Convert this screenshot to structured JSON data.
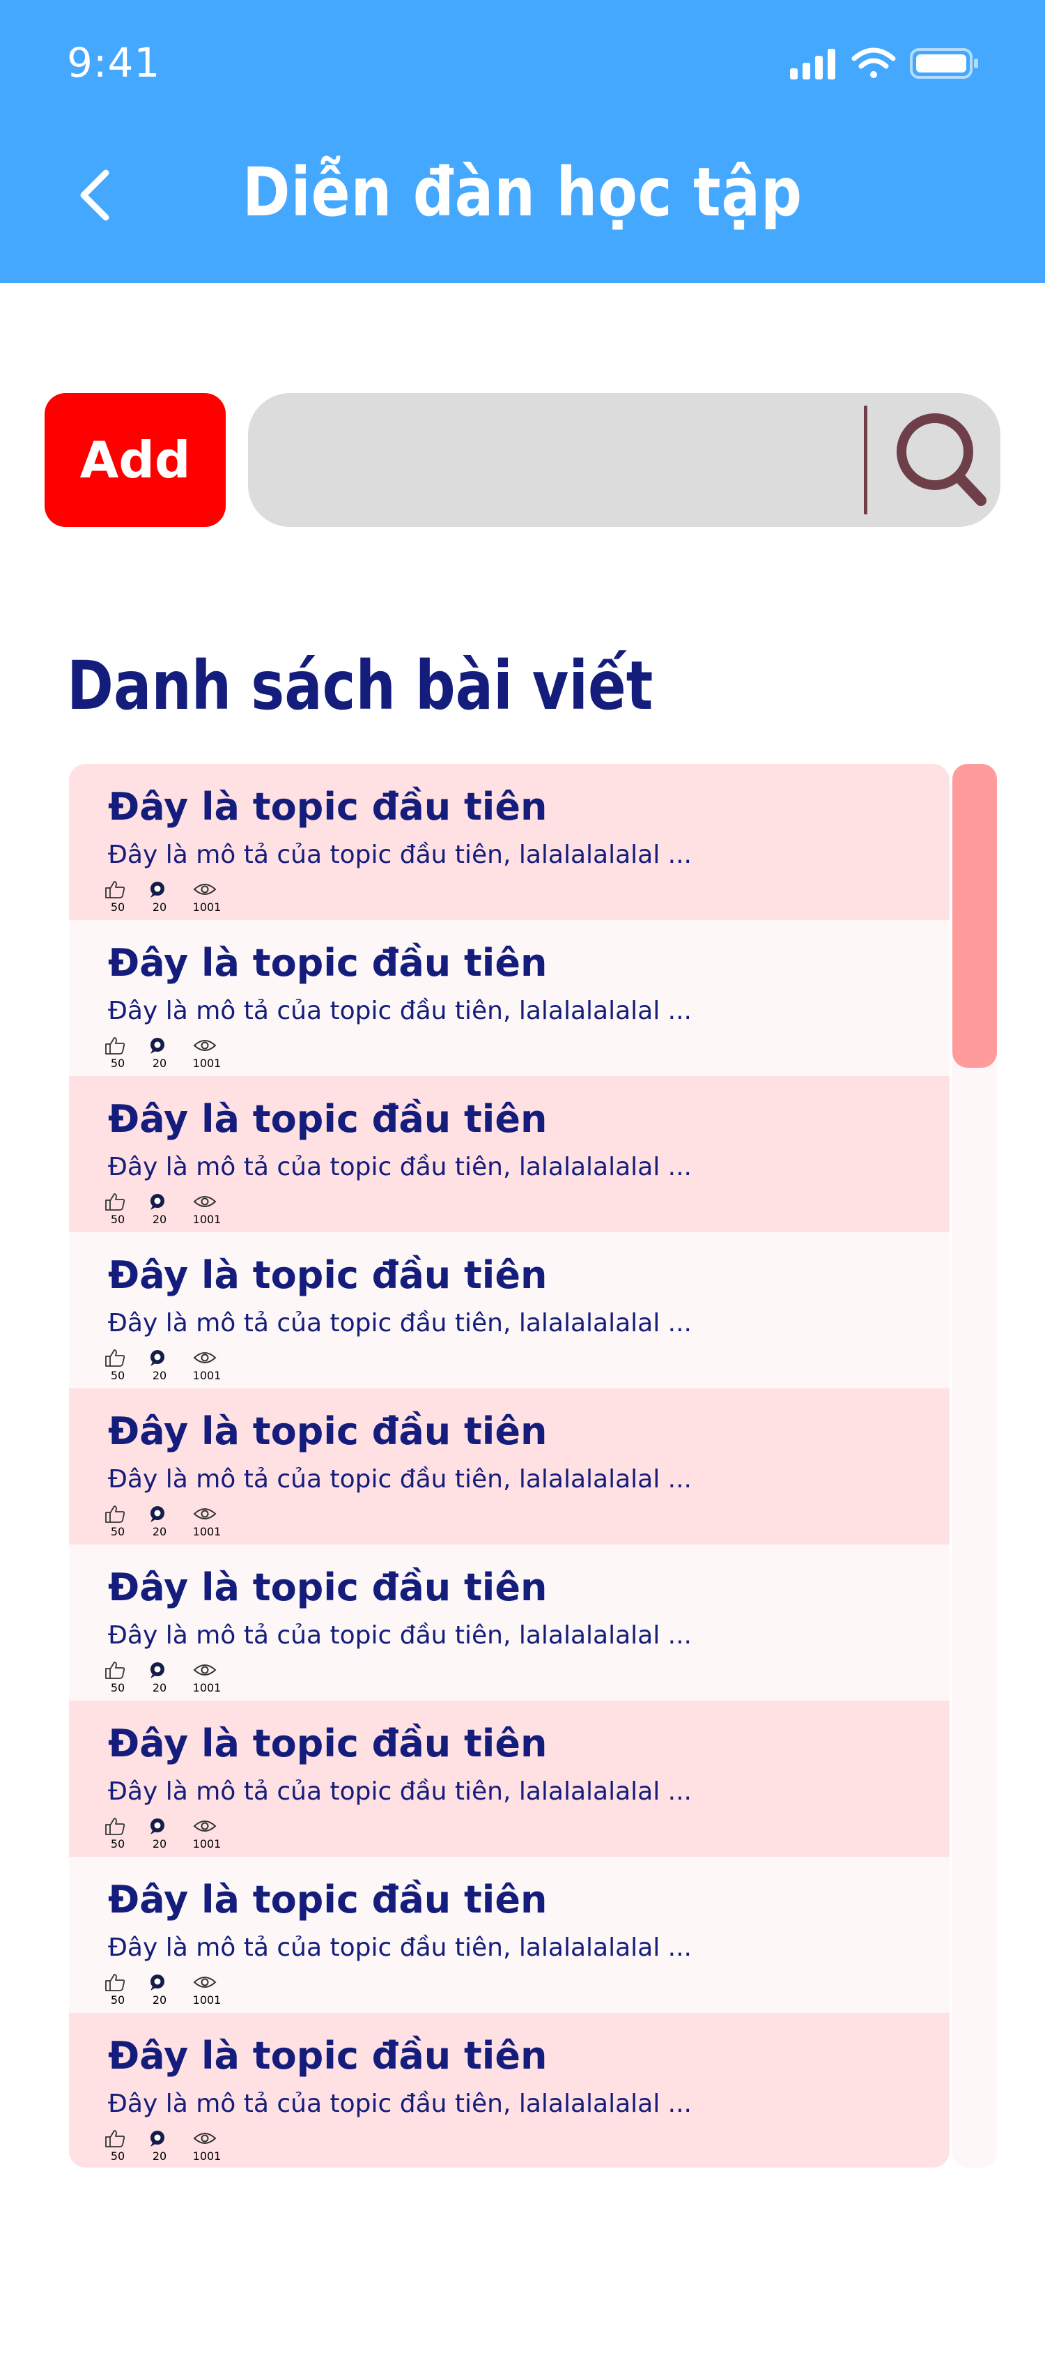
{
  "status_bar": {
    "time": "9:41"
  },
  "header": {
    "title": "Diễn đàn học tập"
  },
  "toolbar": {
    "add_label": "Add",
    "search_placeholder": ""
  },
  "section": {
    "title": "Danh sách bài viết"
  },
  "colors": {
    "header": "#44a8ff",
    "add_button": "#ff0000",
    "title_text": "#141d7c",
    "row_pink": "#ffe1e3",
    "row_white": "#fdf7f7",
    "scrollbar": "#ff9b9b"
  },
  "icons": {
    "back": "chevron-left-icon",
    "search": "search-icon",
    "like": "thumbs-up-icon",
    "comment": "comment-icon",
    "view": "eye-icon"
  },
  "posts": [
    {
      "title": "Đây là topic đầu tiên",
      "description": "Đây là mô tả của topic đầu tiên, lalalalalalal ...",
      "likes": "50",
      "comments": "20",
      "views": "1001"
    },
    {
      "title": "Đây là topic đầu tiên",
      "description": "Đây là mô tả của topic đầu tiên, lalalalalalal ...",
      "likes": "50",
      "comments": "20",
      "views": "1001"
    },
    {
      "title": "Đây là topic đầu tiên",
      "description": "Đây là mô tả của topic đầu tiên, lalalalalalal ...",
      "likes": "50",
      "comments": "20",
      "views": "1001"
    },
    {
      "title": "Đây là topic đầu tiên",
      "description": "Đây là mô tả của topic đầu tiên, lalalalalalal ...",
      "likes": "50",
      "comments": "20",
      "views": "1001"
    },
    {
      "title": "Đây là topic đầu tiên",
      "description": "Đây là mô tả của topic đầu tiên, lalalalalalal ...",
      "likes": "50",
      "comments": "20",
      "views": "1001"
    },
    {
      "title": "Đây là topic đầu tiên",
      "description": "Đây là mô tả của topic đầu tiên, lalalalalalal ...",
      "likes": "50",
      "comments": "20",
      "views": "1001"
    },
    {
      "title": "Đây là topic đầu tiên",
      "description": "Đây là mô tả của topic đầu tiên, lalalalalalal ...",
      "likes": "50",
      "comments": "20",
      "views": "1001"
    },
    {
      "title": "Đây là topic đầu tiên",
      "description": "Đây là mô tả của topic đầu tiên, lalalalalalal ...",
      "likes": "50",
      "comments": "20",
      "views": "1001"
    },
    {
      "title": "Đây là topic đầu tiên",
      "description": "Đây là mô tả của topic đầu tiên, lalalalalalal ...",
      "likes": "50",
      "comments": "20",
      "views": "1001"
    }
  ]
}
